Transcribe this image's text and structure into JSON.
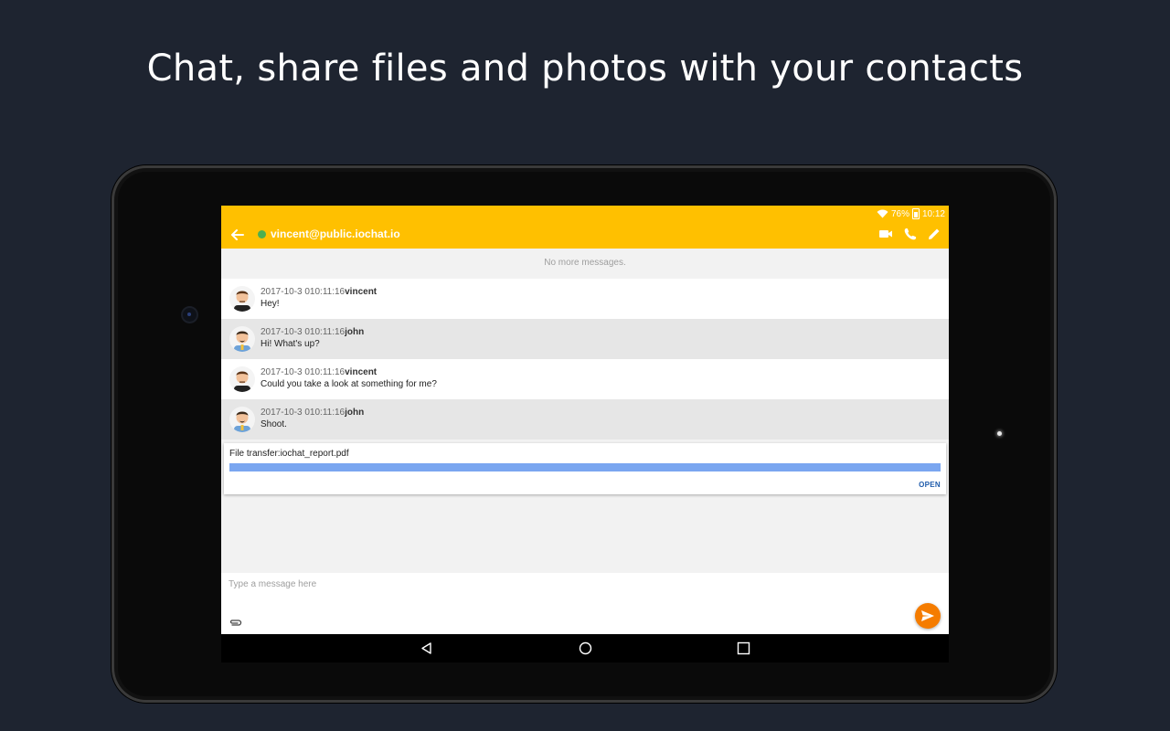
{
  "headline": "Chat, share files and photos with your contacts",
  "status": {
    "battery": "76%",
    "time": "10:12"
  },
  "header": {
    "contact": "vincent@public.iochat.io",
    "presence_color": "#4caf50"
  },
  "colors": {
    "appbar": "#ffc000",
    "send": "#f57c00",
    "progress": "#7aa6f0",
    "open": "#1e5bab"
  },
  "notice": "No more messages.",
  "messages": [
    {
      "timestamp": "2017-10-3 010:11:16",
      "author": "vincent",
      "text": "Hey!"
    },
    {
      "timestamp": "2017-10-3 010:11:16",
      "author": "john",
      "text": "Hi! What's up?"
    },
    {
      "timestamp": "2017-10-3 010:11:16",
      "author": "vincent",
      "text": "Could you take a look at something for me?"
    },
    {
      "timestamp": "2017-10-3 010:11:16",
      "author": "john",
      "text": "Shoot."
    }
  ],
  "file_transfer": {
    "label": "File transfer:iochat_report.pdf",
    "progress_percent": 100,
    "open_label": "OPEN"
  },
  "composer": {
    "placeholder": "Type a message here"
  },
  "icons": [
    "back-arrow-icon",
    "video-call-icon",
    "phone-icon",
    "edit-icon",
    "paperclip-icon",
    "send-icon",
    "nav-back-icon",
    "nav-home-icon",
    "nav-recents-icon",
    "wifi-icon",
    "battery-icon"
  ]
}
